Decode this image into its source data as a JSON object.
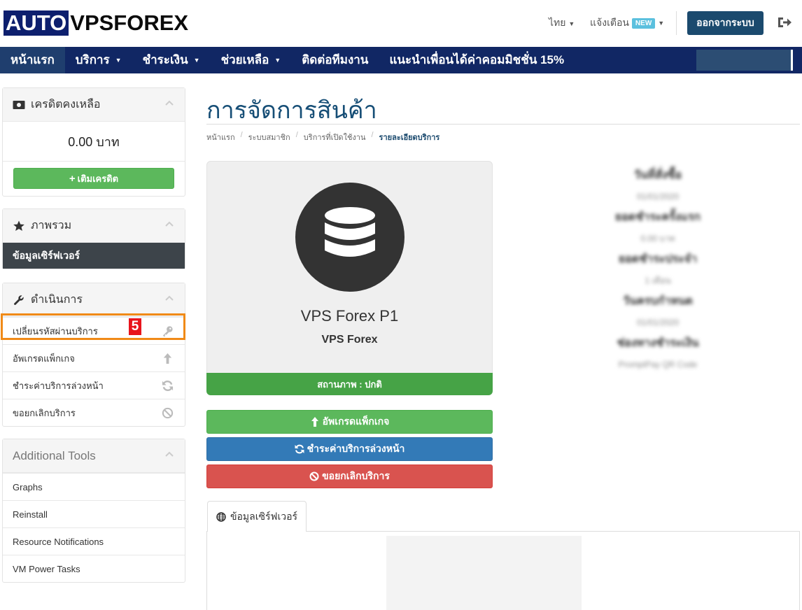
{
  "header": {
    "logo_part1": "AUTO",
    "logo_part2": "VPSFOREX",
    "language": "ไทย",
    "notifications": "แจ้งเตือน",
    "notifications_badge": "NEW",
    "logout": "ออกจากระบบ"
  },
  "nav": {
    "items": [
      {
        "label": "หน้าแรก",
        "active": true
      },
      {
        "label": "บริการ",
        "dropdown": true
      },
      {
        "label": "ชำระเงิน",
        "dropdown": true
      },
      {
        "label": "ช่วยเหลือ",
        "dropdown": true
      },
      {
        "label": "ติดต่อทีมงาน"
      },
      {
        "label": "แนะนำเพื่อนได้ค่าคอมมิชชั่น 15%"
      }
    ]
  },
  "sidebar": {
    "credit": {
      "title": "เครดิตคงเหลือ",
      "amount": "0.00 บาท",
      "add_button": "เติมเครดิต"
    },
    "overview": {
      "title": "ภาพรวม",
      "item": "ข้อมูลเซิร์ฟเวอร์"
    },
    "actions": {
      "title": "ดำเนินการ",
      "items": [
        {
          "label": "เปลี่ยนรหัสผ่านบริการ",
          "icon": "key-icon"
        },
        {
          "label": "อัพเกรดแพ็กเกจ",
          "icon": "arrow-up-icon"
        },
        {
          "label": "ชำระค่าบริการล่วงหน้า",
          "icon": "refresh-icon"
        },
        {
          "label": "ขอยกเลิกบริการ",
          "icon": "ban-icon"
        }
      ],
      "step_marker": "5"
    },
    "tools": {
      "title": "Additional Tools",
      "items": [
        "Graphs",
        "Reinstall",
        "Resource Notifications",
        "VM Power Tasks"
      ]
    }
  },
  "main": {
    "title": "การจัดการสินค้า",
    "breadcrumb": [
      "หน้าแรก",
      "ระบบสมาชิก",
      "บริการที่เปิดใช้งาน",
      "รายละเอียดบริการ"
    ],
    "product": {
      "name": "VPS Forex P1",
      "group": "VPS Forex",
      "icon": "database-icon",
      "status": "สถานภาพ : ปกติ"
    },
    "buttons": {
      "upgrade": "อัพเกรดแพ็กเกจ",
      "renew": "ชำระค่าบริการล่วงหน้า",
      "cancel": "ขอยกเลิกบริการ"
    },
    "details_blurred": [
      {
        "label": "วันที่สั่งซื้อ",
        "value": "01/01/2020"
      },
      {
        "label": "ยอดชำระครั้งแรก",
        "value": "0.00 บาท"
      },
      {
        "label": "ยอดชำระประจำ",
        "value": "1 เดือน"
      },
      {
        "label": "วันครบกำหนด",
        "value": "01/01/2020"
      },
      {
        "label": "ช่องทางชำระเงิน",
        "value": "PromptPay QR Code"
      }
    ],
    "tab": {
      "label": "ข้อมูลเซิร์ฟเวอร์"
    }
  },
  "colors": {
    "navy": "#112764",
    "title_blue": "#164e76",
    "success": "#5cb85c",
    "primary": "#337ab7",
    "danger": "#d9534f",
    "highlight": "#f08a17"
  }
}
